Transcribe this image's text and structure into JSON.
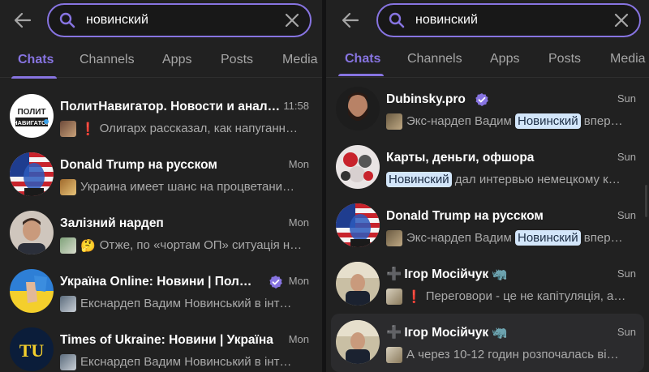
{
  "left": {
    "search": {
      "query": "новинский"
    },
    "tabs": [
      "Chats",
      "Channels",
      "Apps",
      "Posts",
      "Media"
    ],
    "chats": [
      {
        "title": "ПолитНавигатор. Новости и анал…",
        "time": "11:58",
        "prefix": "❗",
        "message": "Олигарх рассказал, как напуганн…",
        "avatar": "politnavigator-logo"
      },
      {
        "title": "Donald Trump на русском",
        "time": "Mon",
        "prefix": "",
        "message": "Украина имеет шанс на процветани…",
        "avatar": "trump-flag-portrait"
      },
      {
        "title": "Залізний нардеп",
        "time": "Mon",
        "prefix": "🤔",
        "message": "Отже, по «чортам ОП» ситуація н…",
        "avatar": "man-portrait"
      },
      {
        "title": "Україна Online: Новини | Політ…",
        "time": "Mon",
        "prefix": "",
        "message": "Екснардеп Вадим Новинський в інт…",
        "avatar": "ukraine-flag-hand",
        "verified": true
      },
      {
        "title": "Times of Ukraine: Новини | Україна",
        "time": "Mon",
        "prefix": "",
        "message": "Екснардеп Вадим Новинський в інт…",
        "avatar": "tu-logo"
      }
    ]
  },
  "right": {
    "search": {
      "query": "новинский"
    },
    "tabs": [
      "Chats",
      "Channels",
      "Apps",
      "Posts",
      "Media"
    ],
    "chats": [
      {
        "title": "Dubinsky.pro",
        "time": "Sun",
        "before": "Экс-нардеп Вадим ",
        "highlight": "Новинский",
        "after": " впер…",
        "avatar": "bearded-man",
        "verified": true
      },
      {
        "title": "Карты, деньги, офшора",
        "time": "Sun",
        "before": "",
        "highlight": "Новинский",
        "after": " дал интервью немецкому к…",
        "avatar": "collage-red"
      },
      {
        "title": "Donald Trump на русском",
        "time": "Sun",
        "before": "Экс-нардеп Вадим ",
        "highlight": "Новинский",
        "after": " впер…",
        "avatar": "trump-flag-portrait"
      },
      {
        "title": "Ігор Мосійчук",
        "time": "Sun",
        "titlePrefix": "➕",
        "titleSuffix": "🦏",
        "prefix": "❗",
        "message": "Переговори - це не капітуляція, а…",
        "avatar": "man-church"
      },
      {
        "title": "Ігор Мосійчук",
        "time": "Sun",
        "titlePrefix": "➕",
        "titleSuffix": "🦏",
        "prefix": "",
        "message": "А через 10-12 годин розпочалась ві…",
        "avatar": "man-church",
        "highlighted": true
      }
    ]
  },
  "colors": {
    "accent": "#8774e1",
    "panel": "#212121",
    "highlight_bg": "#d3e6fa",
    "muted": "#aaaaaa"
  }
}
